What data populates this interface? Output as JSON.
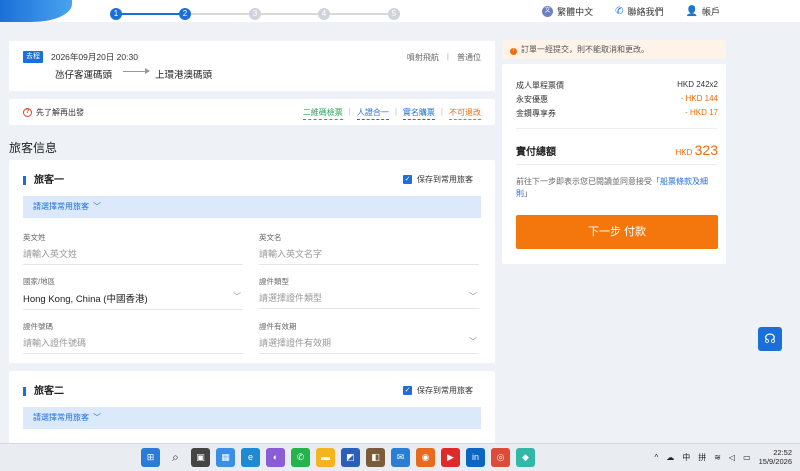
{
  "header": {
    "steps": [
      {
        "label": "",
        "num": "1",
        "active": true
      },
      {
        "label": "",
        "num": "2",
        "active": true
      },
      {
        "label": "",
        "num": "3",
        "active": false
      },
      {
        "label": "",
        "num": "4",
        "active": false
      },
      {
        "label": "",
        "num": "5",
        "active": false
      }
    ],
    "lang": "繁體中文",
    "contact": "聯絡我們",
    "account": "帳戶"
  },
  "trip": {
    "tag": "去程",
    "datetime": "2026年09月20日  20:30",
    "from": "氹仔客運碼頭",
    "to": "上環港澳碼頭",
    "link1": "噴射飛航",
    "link2": "普通位"
  },
  "notice": {
    "warn": "先了解再出發",
    "tag_qr": "二維碼檢票",
    "tag_id": "人證合一",
    "tag_realname": "實名購票",
    "tag_nocancel": "不可退改"
  },
  "section_title": "旅客信息",
  "passenger1": {
    "title": "旅客一",
    "save": "保存到常用旅客",
    "select": "請選擇常用旅客",
    "surname_label": "英文姓",
    "surname_ph": "請輸入英文姓",
    "given_label": "英文名",
    "given_ph": "請輸入英文名字",
    "country_label": "國家/地區",
    "country_val": "Hong Kong, China (中國香港)",
    "idtype_label": "證件類型",
    "idtype_ph": "請選擇證件類型",
    "idno_label": "證件號碼",
    "idno_ph": "請輸入證件號碼",
    "expiry_label": "證件有效期",
    "expiry_ph": "請選擇證件有效期"
  },
  "passenger2": {
    "title": "旅客二",
    "save": "保存到常用旅客",
    "select": "請選擇常用旅客"
  },
  "side": {
    "note": "訂單一經提交，則不能取消和更改。",
    "adult_label": "成人單程票價",
    "adult_val": "HKD 242x2",
    "yongan_label": "永安優惠",
    "yongan_val": "- HKD 144",
    "coupon_label": "金鑽專享券",
    "coupon_val": "- HKD 17",
    "total_label": "實付總額",
    "total_currency": "HKD",
    "total_val": "323",
    "agree_text": "前往下一步即表示您已閱讀並同意接受「",
    "agree_link": "船票條款及細則",
    "agree_end": "」",
    "pay_button": "下一步 付款"
  },
  "taskbar": {
    "ime": "中",
    "ime2": "拼",
    "time": "22:52",
    "date": "15/9/2026"
  },
  "colors": {
    "accent": "#1b6fd8",
    "orange": "#f26a0c"
  }
}
